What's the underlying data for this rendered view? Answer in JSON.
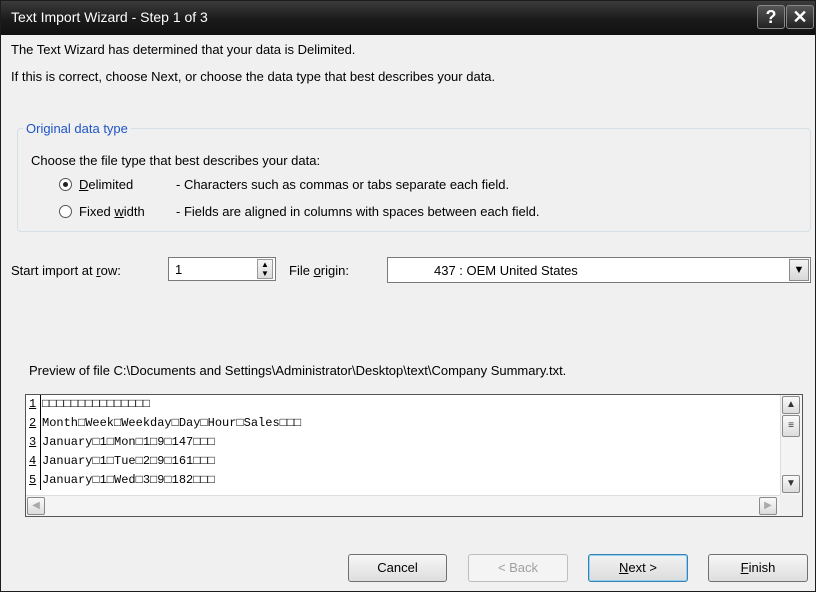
{
  "window": {
    "title": "Text Import Wizard - Step 1 of 3",
    "help_glyph": "?",
    "close_glyph": "✕"
  },
  "intro": {
    "line1": "The Text Wizard has determined that your data is Delimited.",
    "line2": "If this is correct, choose Next, or choose the data type that best describes your data."
  },
  "original_type": {
    "legend": "Original data type",
    "prompt": "Choose the file type that best describes your data:",
    "options": [
      {
        "label_prefix": "",
        "label_accel": "D",
        "label_rest": "elimited",
        "description": "- Characters such as commas or tabs separate each field.",
        "selected": true
      },
      {
        "label_prefix": "Fixed ",
        "label_accel": "w",
        "label_rest": "idth",
        "description": "- Fields are aligned in columns with spaces between each field.",
        "selected": false
      }
    ]
  },
  "start_row": {
    "label_prefix": "Start import at ",
    "label_accel": "r",
    "label_rest": "ow:",
    "value": "1"
  },
  "file_origin": {
    "label_prefix": "File ",
    "label_accel": "o",
    "label_rest": "rigin:",
    "value": "437 : OEM United States"
  },
  "preview": {
    "label": "Preview of file C:\\Documents and Settings\\Administrator\\Desktop\\text\\Company Summary.txt.",
    "rows": [
      {
        "num": "1",
        "text": "□□□□□□□□□□□□□□□"
      },
      {
        "num": "2",
        "text": "Month□Week□Weekday□Day□Hour□Sales□□□"
      },
      {
        "num": "3",
        "text": "January□1□Mon□1□9□147□□□"
      },
      {
        "num": "4",
        "text": "January□1□Tue□2□9□161□□□"
      },
      {
        "num": "5",
        "text": "January□1□Wed□3□9□182□□□"
      }
    ]
  },
  "buttons": {
    "cancel": "Cancel",
    "back": "< Back",
    "next_accel": "N",
    "next_rest": "ext >",
    "finish_accel": "F",
    "finish_rest": "inish"
  }
}
